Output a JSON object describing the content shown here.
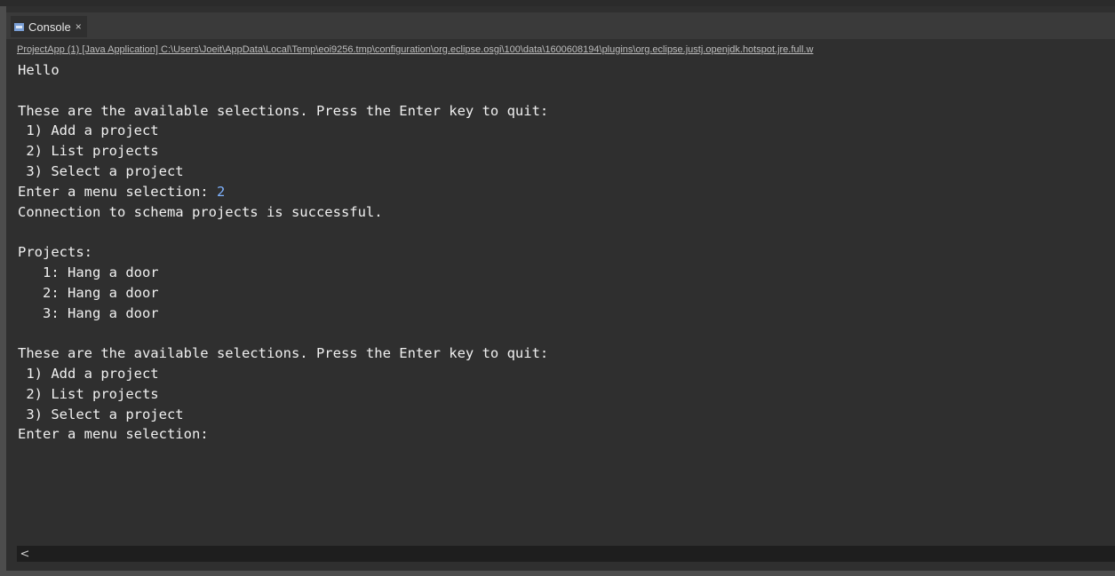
{
  "tab": {
    "label": "Console",
    "icon": "console-icon",
    "close": "×"
  },
  "status_line": "ProjectApp (1) [Java Application] C:\\Users\\Joeit\\AppData\\Local\\Temp\\eoi9256.tmp\\configuration\\org.eclipse.osgi\\100\\data\\1600608194\\plugins\\org.eclipse.justj.openjdk.hotspot.jre.full.w",
  "output": [
    {
      "text": "Hello"
    },
    {
      "text": ""
    },
    {
      "text": "These are the available selections. Press the Enter key to quit:"
    },
    {
      "text": " 1) Add a project"
    },
    {
      "text": " 2) List projects"
    },
    {
      "text": " 3) Select a project"
    },
    {
      "text": "Enter a menu selection: ",
      "input": "2"
    },
    {
      "text": "Connection to schema projects is successful."
    },
    {
      "text": ""
    },
    {
      "text": "Projects:"
    },
    {
      "text": "   1: Hang a door"
    },
    {
      "text": "   2: Hang a door"
    },
    {
      "text": "   3: Hang a door"
    },
    {
      "text": ""
    },
    {
      "text": "These are the available selections. Press the Enter key to quit:"
    },
    {
      "text": " 1) Add a project"
    },
    {
      "text": " 2) List projects"
    },
    {
      "text": " 3) Select a project"
    },
    {
      "text": "Enter a menu selection:"
    }
  ],
  "scrollbar": {
    "left_arrow": "<"
  },
  "colors": {
    "background": "#2f2f2f",
    "text": "#f0f0f0",
    "input": "#7fb3ff",
    "status_line": "#bdbdbd"
  }
}
